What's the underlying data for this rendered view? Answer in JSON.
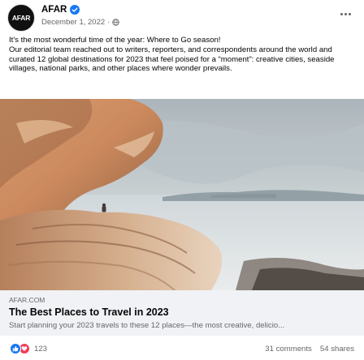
{
  "post": {
    "author": "AFAR",
    "avatar_text": "AFAR",
    "date": "December 1, 2022",
    "date_separator": "·",
    "caption_line1": "It's the most wonderful time of the year: Where to Go season!",
    "caption_line2": "Our editorial team reached out to writers, reporters, and correspondents around the world and curated 12 global destinations for 2023 that feel poised for a “moment”: creative cities, seaside villages, national parks, and other places where wonder prevails."
  },
  "link": {
    "domain": "AFAR.COM",
    "title": "The Best Places to Travel in 2023",
    "description": "Start planning your 2023 travels to these 12 places—the most creative, delicio..."
  },
  "footer": {
    "reaction_count": "123",
    "comments": "31 comments",
    "shares": "54 shares"
  },
  "icons": [
    "verified-icon",
    "globe-icon",
    "more-icon",
    "like-icon",
    "love-icon"
  ],
  "colors": {
    "accent": "#1877f2",
    "love": "#f33e58",
    "secondary_text": "#65676b",
    "card_bg": "#f0f2f5"
  }
}
